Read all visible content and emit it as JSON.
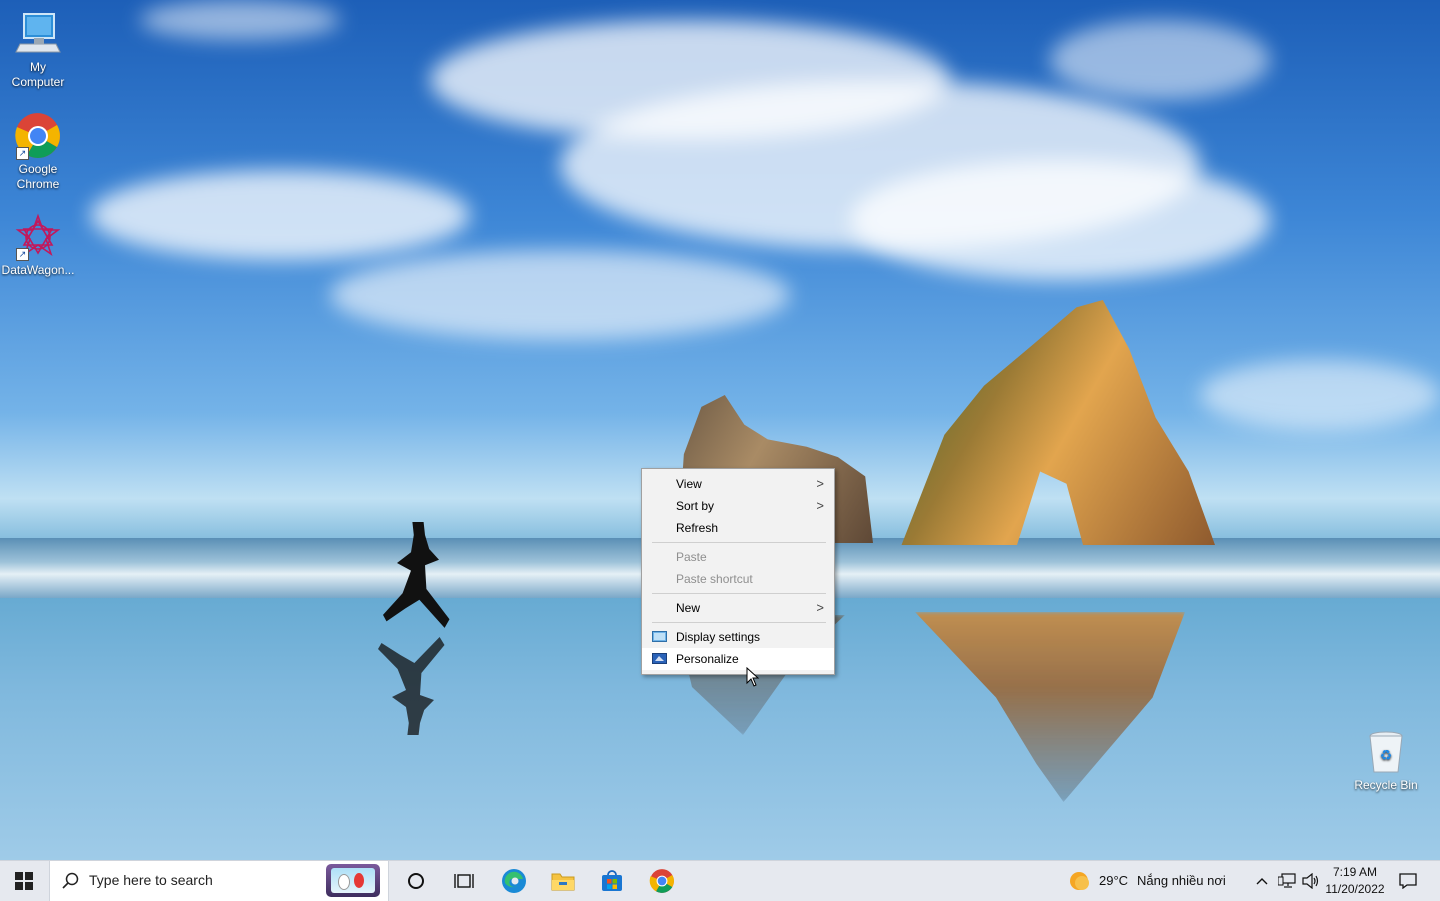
{
  "desktop": {
    "icons": [
      {
        "label_line1": "My",
        "label_line2": "Computer",
        "icon": "computer-icon"
      },
      {
        "label_line1": "Google",
        "label_line2": "Chrome",
        "icon": "chrome-icon"
      },
      {
        "label_line1": "DataWagon...",
        "label_line2": "",
        "icon": "datawagon-icon"
      }
    ],
    "recycle_bin": {
      "label": "Recycle Bin",
      "icon": "recycle-bin-icon"
    }
  },
  "context_menu": {
    "items": [
      {
        "label": "View",
        "submenu": true,
        "enabled": true
      },
      {
        "label": "Sort by",
        "submenu": true,
        "enabled": true
      },
      {
        "label": "Refresh",
        "submenu": false,
        "enabled": true
      },
      {
        "label": "Paste",
        "submenu": false,
        "enabled": false
      },
      {
        "label": "Paste shortcut",
        "submenu": false,
        "enabled": false
      },
      {
        "label": "New",
        "submenu": true,
        "enabled": true
      },
      {
        "label": "Display settings",
        "submenu": false,
        "enabled": true,
        "icon": "display-settings-icon"
      },
      {
        "label": "Personalize",
        "submenu": false,
        "enabled": true,
        "icon": "personalize-icon",
        "hovered": true
      }
    ],
    "submenu_arrow": ">"
  },
  "taskbar": {
    "search_placeholder": "Type here to search",
    "pinned": [
      "cortana-icon",
      "task-view-icon",
      "edge-icon",
      "file-explorer-icon",
      "microsoft-store-icon",
      "chrome-icon"
    ],
    "weather": {
      "temp": "29°C",
      "condition": "Nắng nhiều nơi"
    },
    "clock": {
      "time": "7:19 AM",
      "date": "11/20/2022"
    }
  },
  "colors": {
    "taskbar_bg": "#e6e9ef",
    "menu_bg": "#f2f2f2",
    "menu_disabled_text": "#8f8f8f",
    "windows_blue": "#0078d7"
  }
}
